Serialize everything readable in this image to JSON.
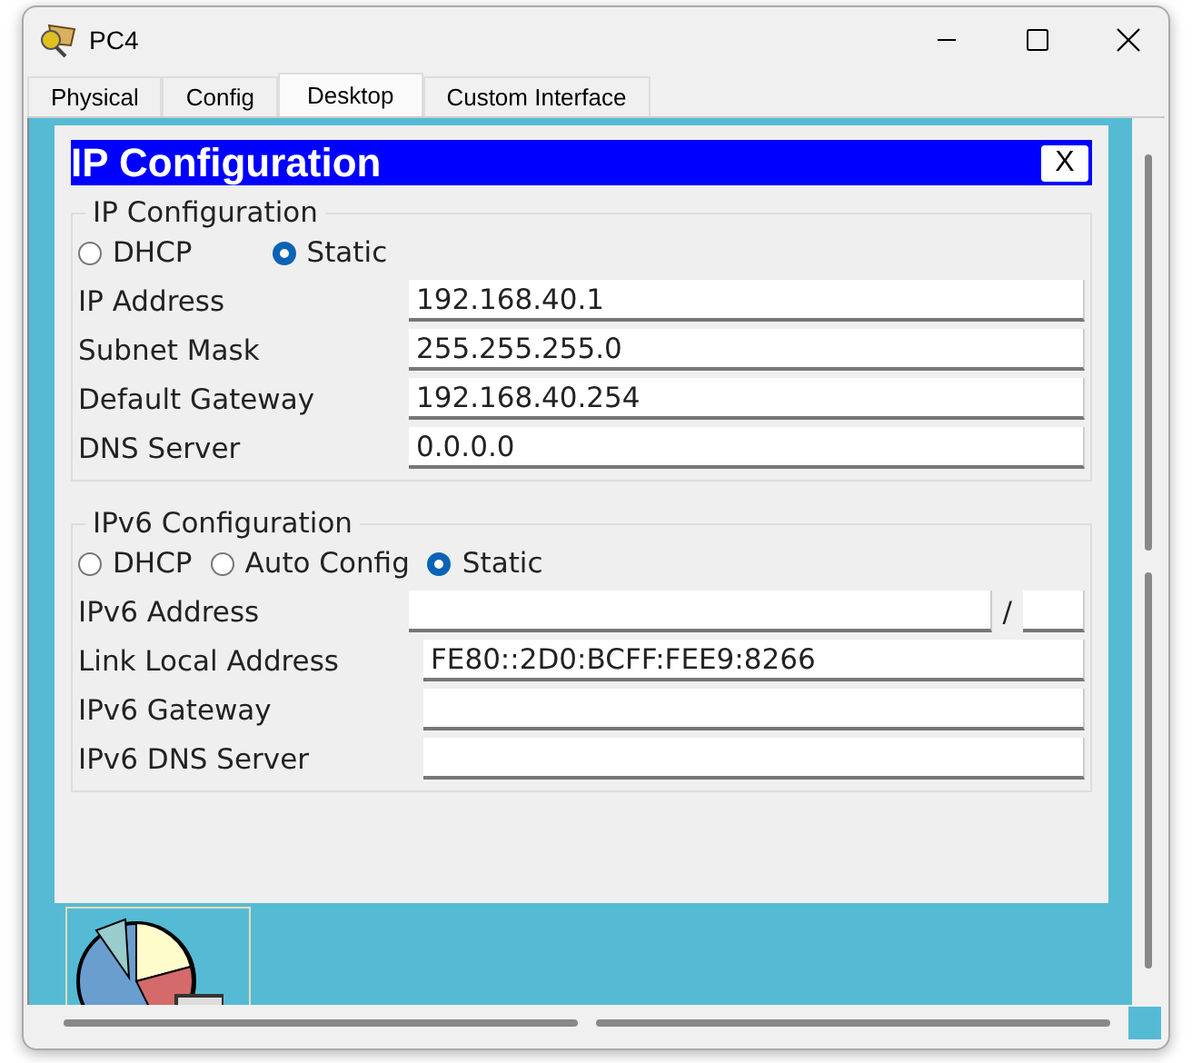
{
  "window": {
    "title": "PC4"
  },
  "tabs": [
    {
      "label": "Physical",
      "selected": false
    },
    {
      "label": "Config",
      "selected": false
    },
    {
      "label": "Desktop",
      "selected": true
    },
    {
      "label": "Custom Interface",
      "selected": false
    }
  ],
  "dialog": {
    "title": "IP Configuration",
    "close": "X",
    "ipv4": {
      "legend": "IP Configuration",
      "modes": [
        {
          "label": "DHCP",
          "selected": false
        },
        {
          "label": "Static",
          "selected": true
        }
      ],
      "fields": [
        {
          "label": "IP Address",
          "value": "192.168.40.1"
        },
        {
          "label": "Subnet Mask",
          "value": "255.255.255.0"
        },
        {
          "label": "Default Gateway",
          "value": "192.168.40.254"
        },
        {
          "label": "DNS Server",
          "value": "0.0.0.0"
        }
      ]
    },
    "ipv6": {
      "legend": "IPv6 Configuration",
      "modes": [
        {
          "label": "DHCP",
          "selected": false
        },
        {
          "label": "Auto Config",
          "selected": false
        },
        {
          "label": "Static",
          "selected": true
        }
      ],
      "address": {
        "label": "IPv6 Address",
        "separator": "/"
      },
      "fields": [
        {
          "label": "Link Local Address",
          "value": "FE80::2D0:BCFF:FEE9:8266"
        },
        {
          "label": "IPv6 Gateway"
        },
        {
          "label": "IPv6 DNS Server"
        }
      ]
    }
  }
}
